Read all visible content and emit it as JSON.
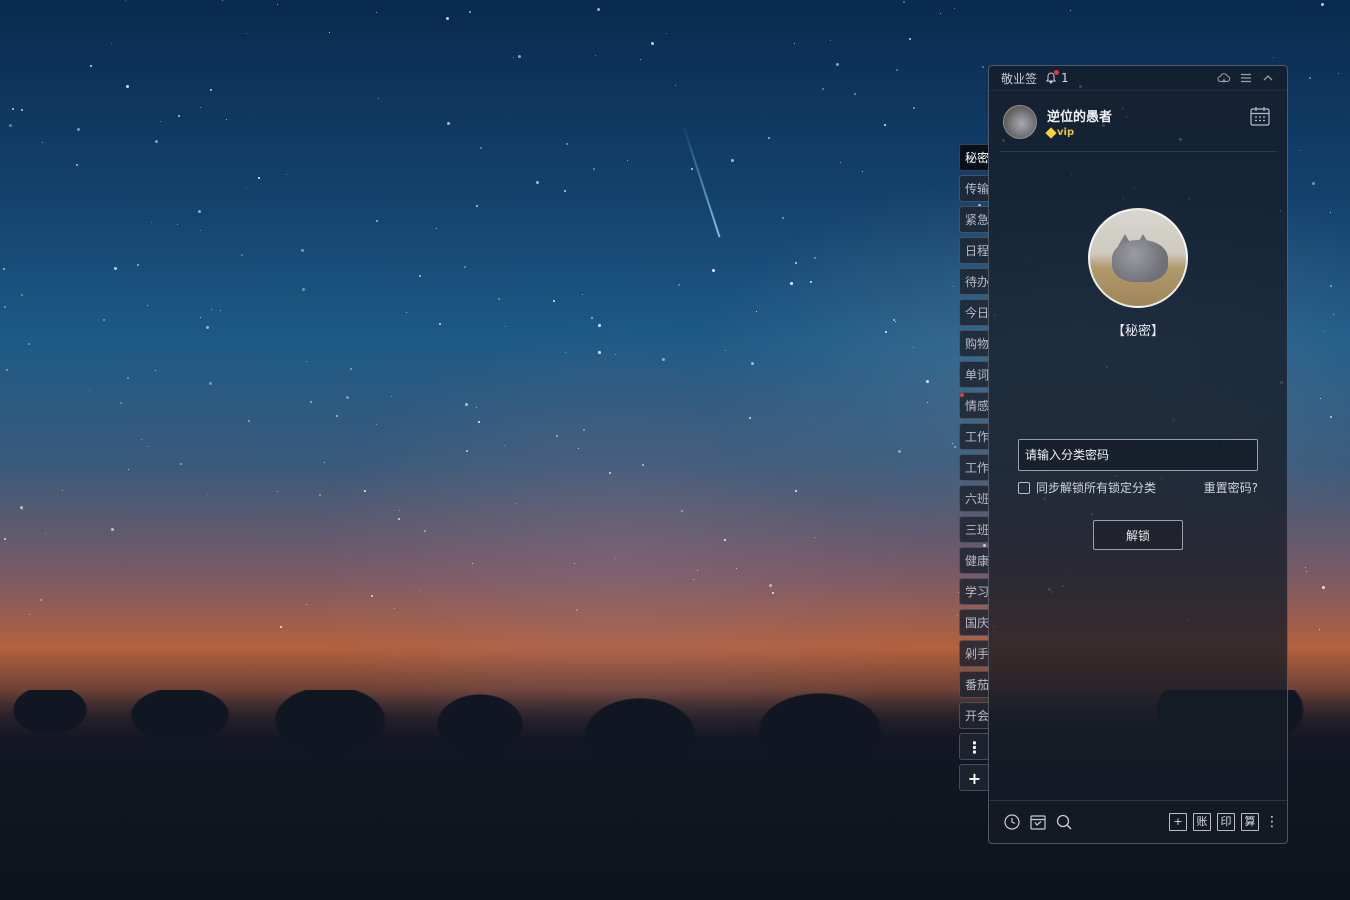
{
  "titlebar": {
    "app_name": "敬业签",
    "notification_count": "1",
    "icons": [
      "bell-icon",
      "cloud-sync-icon",
      "menu-icon",
      "collapse-icon"
    ]
  },
  "user": {
    "name": "逆位的愚者",
    "vip_label": "vip"
  },
  "side_tabs": [
    {
      "label": "秘密",
      "active": true
    },
    {
      "label": "传输"
    },
    {
      "label": "紧急"
    },
    {
      "label": "日程"
    },
    {
      "label": "待办"
    },
    {
      "label": "今日"
    },
    {
      "label": "购物"
    },
    {
      "label": "单词"
    },
    {
      "label": "情感"
    },
    {
      "label": "工作"
    },
    {
      "label": "工作"
    },
    {
      "label": "六班"
    },
    {
      "label": "三班"
    },
    {
      "label": "健康"
    },
    {
      "label": "学习"
    },
    {
      "label": "国庆"
    },
    {
      "label": "剁手"
    },
    {
      "label": "番茄"
    },
    {
      "label": "开会"
    }
  ],
  "side_actions": {
    "more": "⋮",
    "add": "+"
  },
  "lock": {
    "category_label": "【秘密】",
    "password_placeholder": "请输入分类密码",
    "sync_unlock_label": "同步解锁所有锁定分类",
    "reset_password_label": "重置密码?",
    "unlock_button": "解锁"
  },
  "bottombar": {
    "left_icons": [
      "clock-icon",
      "calendar-check-icon",
      "search-icon"
    ],
    "right_buttons": {
      "add": "+",
      "account": "账",
      "print": "印",
      "calc": "算",
      "more": "⋮"
    }
  },
  "colors": {
    "panel_bg": "#161c26",
    "vip_gold": "#e8c23c",
    "notification_red": "#e03c3c"
  }
}
